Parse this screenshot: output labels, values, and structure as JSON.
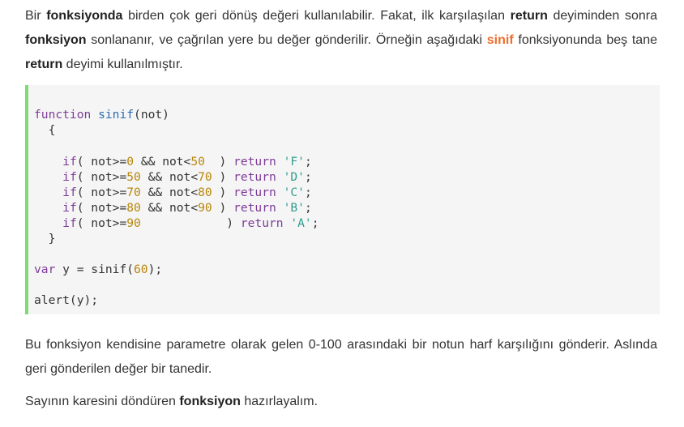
{
  "paragraph1": {
    "t1": "Bir ",
    "b1": "fonksiyonda",
    "t2": " birden çok geri dönüş değeri kullanılabilir. Fakat, ilk karşılaşılan ",
    "b2": "return",
    "t3": " deyiminden sonra ",
    "b3": "fonksiyon",
    "t4": " sonlananır, ve çağrılan yere bu değer gönderilir. Örneğin aşağıdaki ",
    "b4": "sinif",
    "t5": " fonksiyonunda beş tane ",
    "b5": "return",
    "t6": " deyimi kullanılmıştır."
  },
  "code": {
    "function_kw": "function",
    "func_name": "sinif",
    "params": "(not)",
    "open_brace": "  {",
    "if_kw": "if",
    "return_kw": "return",
    "conditions": [
      {
        "pre": "( not>=",
        "a": "0",
        "mid": " && not<",
        "b": "50",
        "post": "  ) ",
        "grade": "'F'"
      },
      {
        "pre": "( not>=",
        "a": "50",
        "mid": " && not<",
        "b": "70",
        "post": " ) ",
        "grade": "'D'"
      },
      {
        "pre": "( not>=",
        "a": "70",
        "mid": " && not<",
        "b": "80",
        "post": " ) ",
        "grade": "'C'"
      },
      {
        "pre": "( not>=",
        "a": "80",
        "mid": " && not<",
        "b": "90",
        "post": " ) ",
        "grade": "'B'"
      },
      {
        "pre": "( not>=",
        "a": "90",
        "mid": "",
        "b": "",
        "post": "            ) ",
        "grade": "'A'"
      }
    ],
    "close_brace": "  }",
    "var_kw": "var",
    "var_rest": " y = sinif(",
    "var_arg": "60",
    "var_end": ");",
    "alert_line": "alert(y);"
  },
  "paragraph2": {
    "text": "Bu fonksiyon kendisine parametre olarak gelen 0-100 arasındaki bir notun harf karşılığını gönderir. Aslında geri gönderilen değer bir tanedir."
  },
  "paragraph3": {
    "t1": "Sayının karesini döndüren ",
    "b1": "fonksiyon",
    "t2": " hazırlayalım."
  },
  "colors": {
    "accent": "#f06d2c",
    "code_border": "#7fdc73",
    "code_bg": "#f5f5f5",
    "keyword": "#7d3c98",
    "number": "#b8860b",
    "string": "#2e9e8e"
  }
}
